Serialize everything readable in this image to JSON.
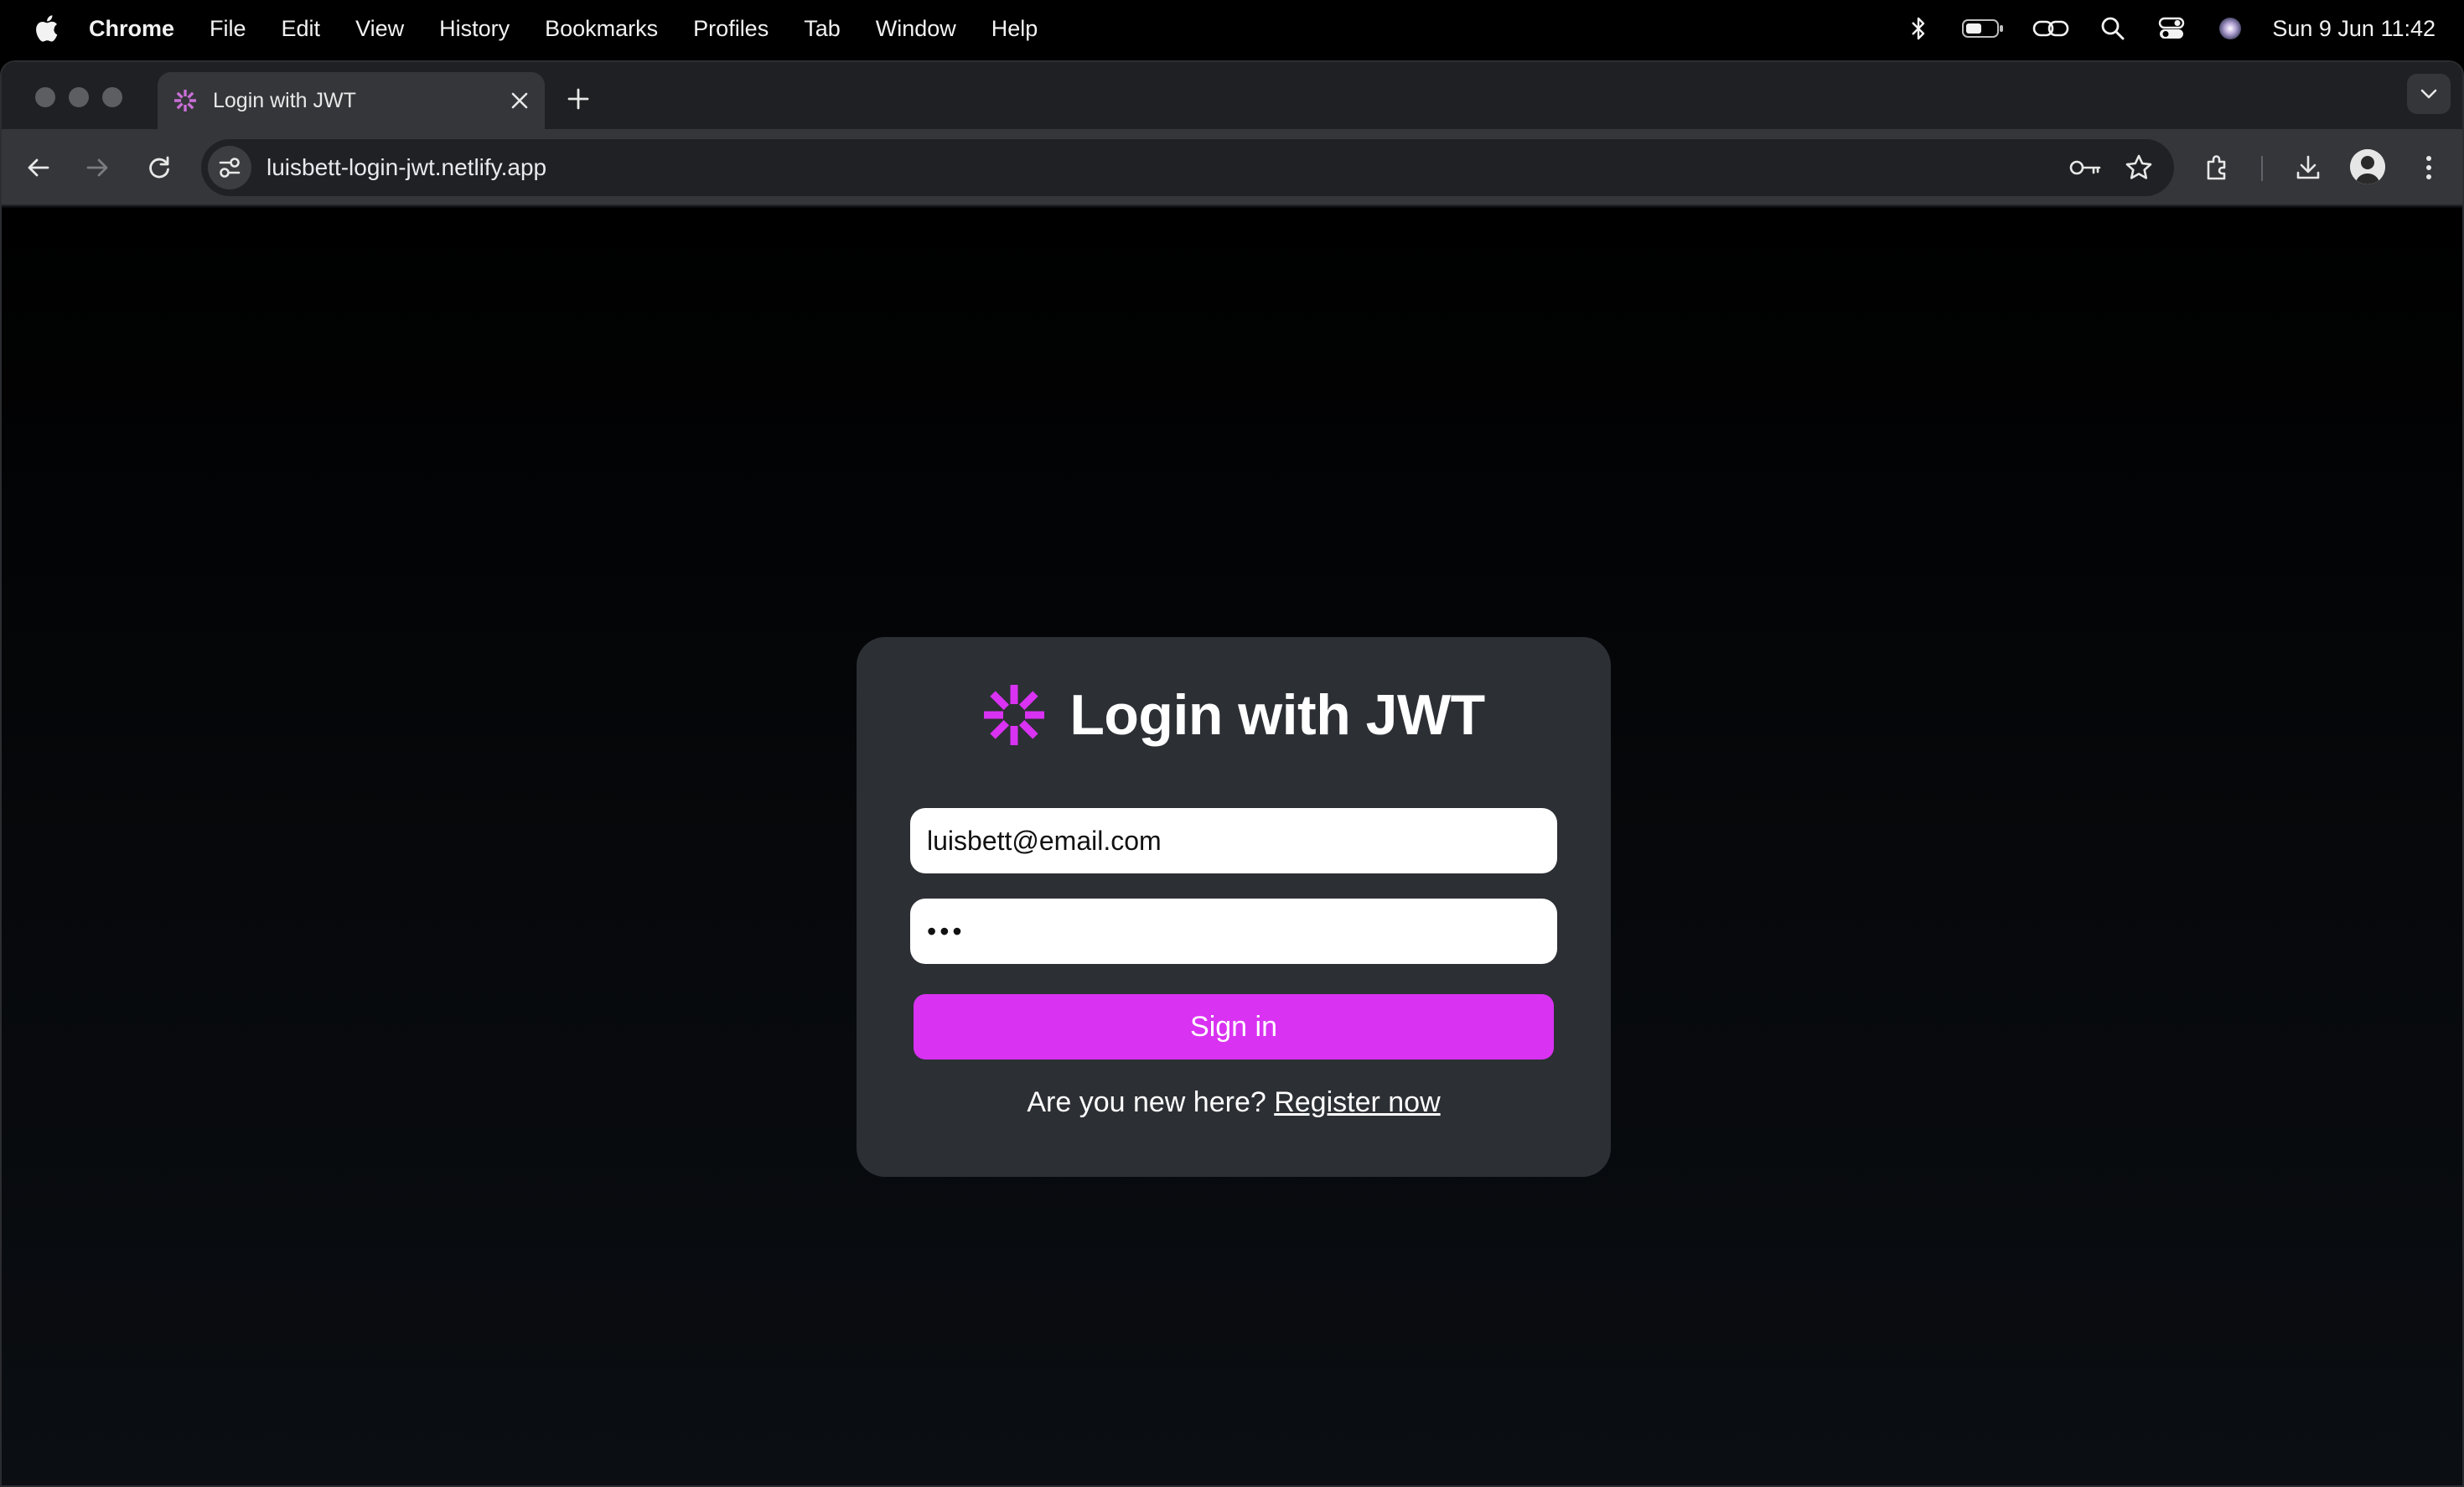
{
  "menubar": {
    "app_name": "Chrome",
    "items": [
      "File",
      "Edit",
      "View",
      "History",
      "Bookmarks",
      "Profiles",
      "Tab",
      "Window",
      "Help"
    ],
    "clock": "Sun 9 Jun  11:42"
  },
  "browser": {
    "tab": {
      "title": "Login with JWT"
    },
    "url": "luisbett-login-jwt.netlify.app"
  },
  "login": {
    "title": "Login with JWT",
    "email_value": "luisbett@email.com",
    "password_value": "•••",
    "signin_label": "Sign in",
    "register_prompt": "Are you new here?",
    "register_link": "Register now"
  },
  "colors": {
    "accent": "#d932f2",
    "card_bg": "#2c2f34",
    "page_bg": "#000000"
  },
  "icons": {
    "menubar": [
      "apple-icon",
      "bluetooth-icon",
      "battery-icon",
      "link-icon",
      "spotlight-search-icon",
      "control-center-icon",
      "siri-icon"
    ],
    "toolbar": [
      "back-icon",
      "forward-icon",
      "reload-icon",
      "site-info-icon",
      "password-key-icon",
      "bookmark-star-icon",
      "extensions-icon",
      "download-icon",
      "profile-avatar",
      "more-menu-icon"
    ]
  }
}
